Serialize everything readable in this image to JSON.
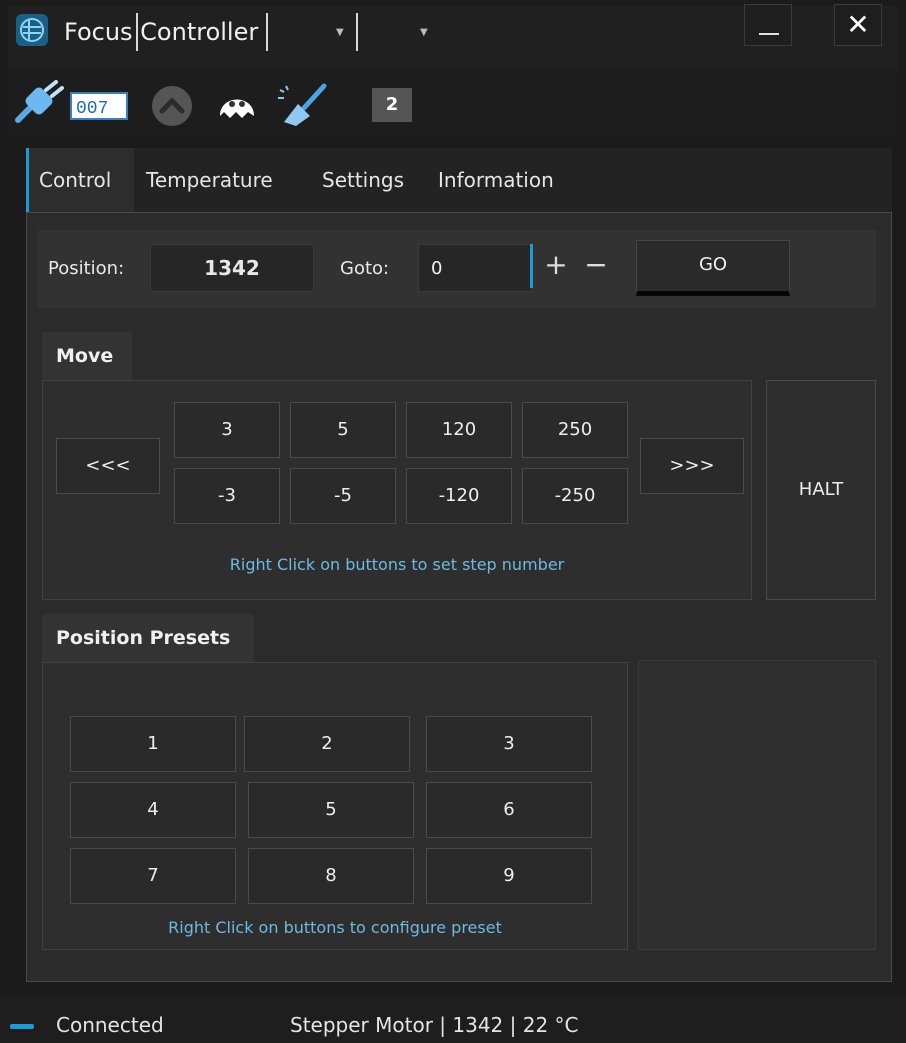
{
  "window": {
    "title": "Focus Controller",
    "minimize_icon": "minimize-icon",
    "close_label": "✕"
  },
  "toolbar": {
    "icons": [
      "connect-plug-icon",
      "counter-icon",
      "chevron-up-icon",
      "ghost-icon",
      "broom-icon",
      "badge-icon"
    ],
    "badge": "2"
  },
  "tabs": [
    {
      "label": "Control",
      "active": true
    },
    {
      "label": "Temperature",
      "active": false
    },
    {
      "label": "Settings",
      "active": false
    },
    {
      "label": "Information",
      "active": false
    }
  ],
  "position": {
    "label": "Position:",
    "value": "1342",
    "goto_label": "Goto:",
    "goto_value": "0",
    "plus": "+",
    "minus": "−",
    "go_label": "GO"
  },
  "move": {
    "title": "Move",
    "left_label": "<<<",
    "right_label": ">>>",
    "forward_steps": [
      "3",
      "5",
      "120",
      "250"
    ],
    "backward_steps": [
      "-3",
      "-5",
      "-120",
      "-250"
    ],
    "halt_label": "HALT",
    "hint": "Right Click on buttons to set step number"
  },
  "presets": {
    "title": "Position Presets",
    "buttons": [
      "1",
      "2",
      "3",
      "4",
      "5",
      "6",
      "7",
      "8",
      "9"
    ],
    "hint": "Right Click on buttons to configure preset"
  },
  "status": {
    "connection": "Connected",
    "info": "Stepper Motor | 1342 | 22 °C"
  },
  "colors": {
    "accent": "#1e9bd7",
    "hint_text": "#6fb9e0",
    "background": "#1b1b1b"
  }
}
